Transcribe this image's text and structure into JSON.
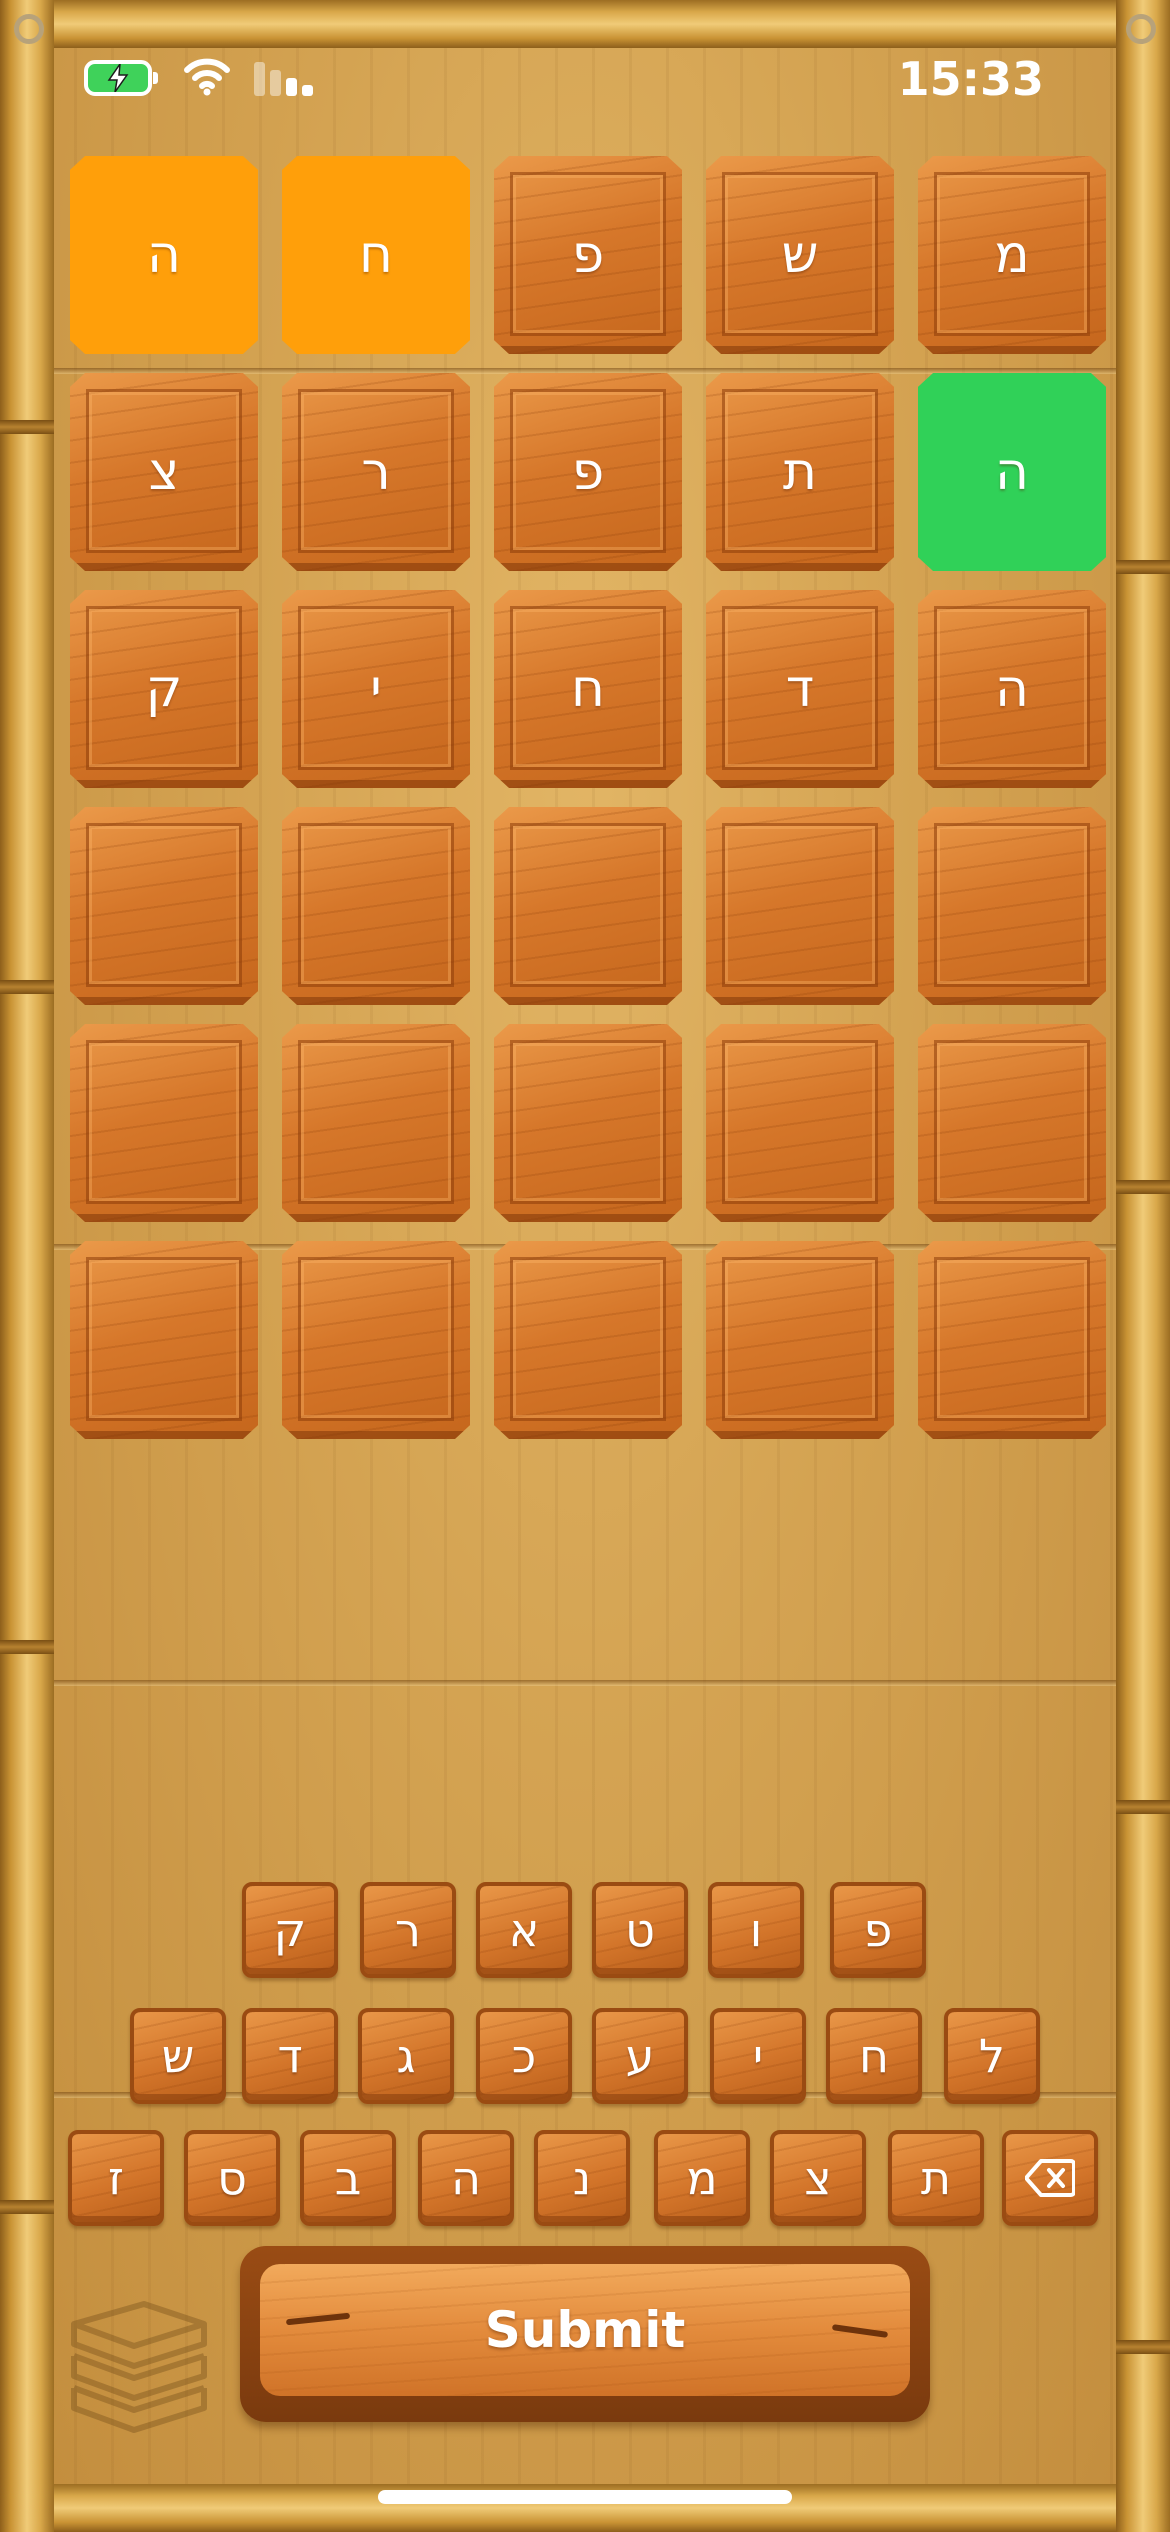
{
  "status_bar": {
    "time": "15:33",
    "battery_color": "#3fd25a",
    "icons": [
      "charging-battery-icon",
      "wifi-icon",
      "cellular-signal-icon"
    ]
  },
  "board": {
    "rows": [
      [
        {
          "letter": "ה",
          "state": "orange"
        },
        {
          "letter": "ח",
          "state": "orange"
        },
        {
          "letter": "פ",
          "state": "wood"
        },
        {
          "letter": "ש",
          "state": "wood"
        },
        {
          "letter": "מ",
          "state": "wood"
        }
      ],
      [
        {
          "letter": "צ",
          "state": "wood"
        },
        {
          "letter": "ר",
          "state": "wood"
        },
        {
          "letter": "פ",
          "state": "wood"
        },
        {
          "letter": "ת",
          "state": "wood"
        },
        {
          "letter": "ה",
          "state": "green"
        }
      ],
      [
        {
          "letter": "ק",
          "state": "wood"
        },
        {
          "letter": "י",
          "state": "wood"
        },
        {
          "letter": "ח",
          "state": "wood"
        },
        {
          "letter": "ד",
          "state": "wood"
        },
        {
          "letter": "ה",
          "state": "wood"
        }
      ],
      [
        {
          "letter": "",
          "state": "wood"
        },
        {
          "letter": "",
          "state": "wood"
        },
        {
          "letter": "",
          "state": "wood"
        },
        {
          "letter": "",
          "state": "wood"
        },
        {
          "letter": "",
          "state": "wood"
        }
      ],
      [
        {
          "letter": "",
          "state": "wood"
        },
        {
          "letter": "",
          "state": "wood"
        },
        {
          "letter": "",
          "state": "wood"
        },
        {
          "letter": "",
          "state": "wood"
        },
        {
          "letter": "",
          "state": "wood"
        }
      ],
      [
        {
          "letter": "",
          "state": "wood"
        },
        {
          "letter": "",
          "state": "wood"
        },
        {
          "letter": "",
          "state": "wood"
        },
        {
          "letter": "",
          "state": "wood"
        },
        {
          "letter": "",
          "state": "wood"
        }
      ]
    ],
    "colors": {
      "orange": "#ff9f0a",
      "green": "#30d158"
    }
  },
  "keyboard": {
    "row1": [
      "ק",
      "ר",
      "א",
      "ט",
      "ו",
      "פ"
    ],
    "row2": [
      "ש",
      "ד",
      "ג",
      "כ",
      "ע",
      "י",
      "ח",
      "ל"
    ],
    "row3": [
      "ז",
      "ס",
      "ב",
      "ה",
      "נ",
      "מ",
      "צ",
      "ת"
    ],
    "backspace_icon": "backspace-icon"
  },
  "submit_label": "Submit",
  "decor": {
    "books_icon": "stacked-books-icon"
  }
}
